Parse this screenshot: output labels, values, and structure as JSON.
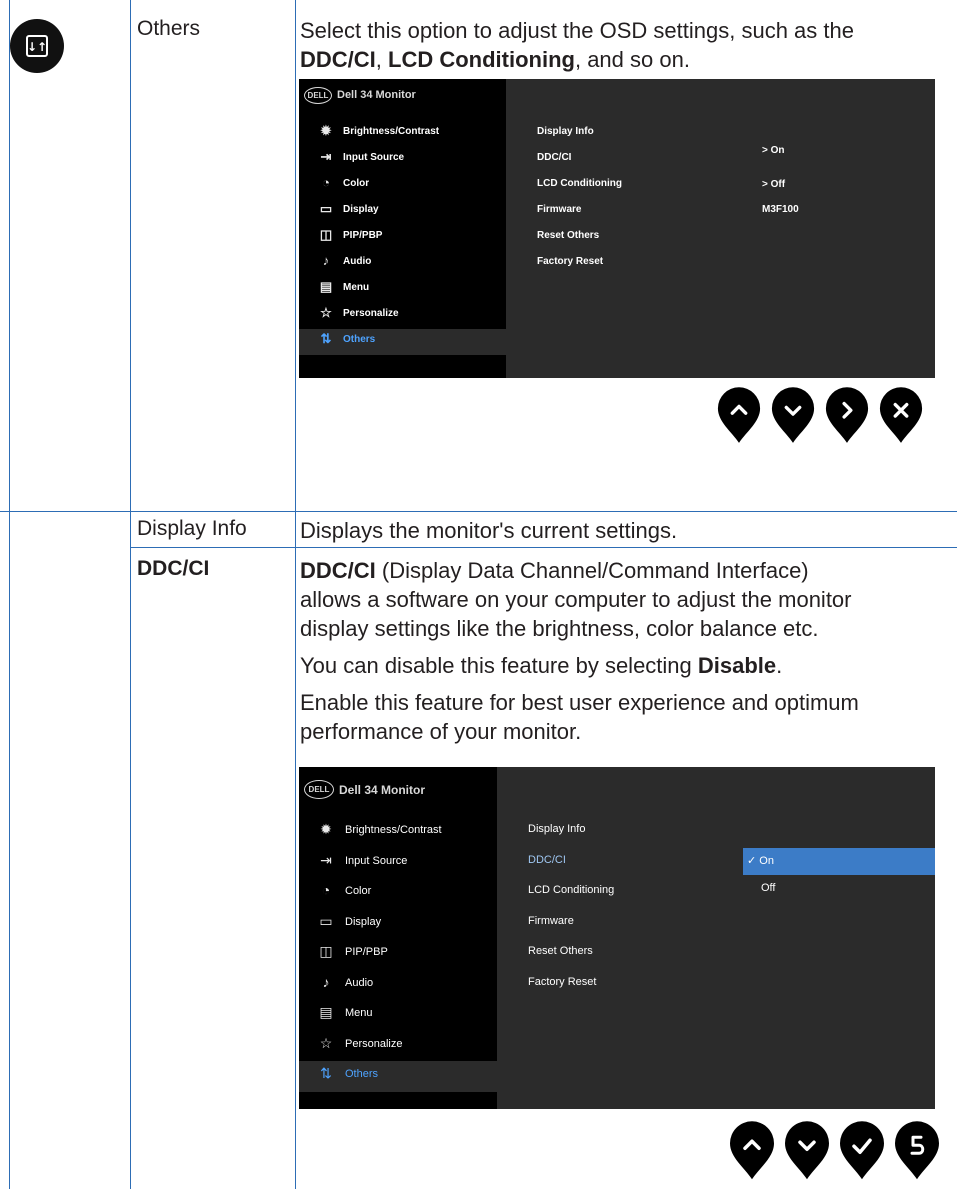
{
  "rows": {
    "others": {
      "label": "Others",
      "desc_line1": "Select this option to adjust the OSD settings, such as the",
      "desc_b1": "DDC/CI",
      "desc_sep": ", ",
      "desc_b2": "LCD Conditioning",
      "desc_end": ", and so on."
    },
    "display_info": {
      "label": "Display Info",
      "desc": "Displays the monitor's current settings."
    },
    "ddcci": {
      "label": "DDC/CI",
      "p1_b": "DDC/CI",
      "p1_rest1": " (Display Data Channel/Command Interface)",
      "p1_line2": "allows a software on your computer to adjust the monitor",
      "p1_line3": "display settings like the brightness, color balance etc.",
      "p2_text": "You can disable this feature by selecting ",
      "p2_b": "Disable",
      "p2_end": ".",
      "p3_line1": "Enable this feature for best user experience and optimum",
      "p3_line2": "performance of your monitor."
    }
  },
  "osd": {
    "logo": "DELL",
    "title": "Dell 34 Monitor",
    "menu": [
      {
        "icon": "brightness-icon",
        "glyph": "✹",
        "label": "Brightness/Contrast"
      },
      {
        "icon": "input-source-icon",
        "glyph": "⇥",
        "label": "Input Source"
      },
      {
        "icon": "color-icon",
        "glyph": "◔",
        "label": "Color"
      },
      {
        "icon": "display-icon",
        "glyph": "▭",
        "label": "Display"
      },
      {
        "icon": "pip-pbp-icon",
        "glyph": "◫",
        "label": "PIP/PBP"
      },
      {
        "icon": "audio-icon",
        "glyph": "♪",
        "label": "Audio"
      },
      {
        "icon": "menu-icon",
        "glyph": "▤",
        "label": "Menu"
      },
      {
        "icon": "personalize-icon",
        "glyph": "☆",
        "label": "Personalize"
      },
      {
        "icon": "others-icon",
        "glyph": "⇅",
        "label": "Others"
      }
    ],
    "submenu": [
      "Display Info",
      "DDC/CI",
      "LCD Conditioning",
      "Firmware",
      "Reset Others",
      "Factory Reset"
    ],
    "values1": {
      "ddcci": "> On",
      "lcd": "> Off",
      "firmware": "M3F100"
    },
    "values2": {
      "on": "✓ On",
      "off": "Off"
    }
  },
  "nav1": [
    "up-icon",
    "down-icon",
    "right-icon",
    "close-icon"
  ],
  "nav2": [
    "up-icon",
    "down-icon",
    "check-icon",
    "back-icon"
  ],
  "colors": {
    "border": "#2d6db5",
    "osd_bg": "#2b2b2b",
    "osd_side": "#000000",
    "highlight": "#3c7cc7"
  }
}
